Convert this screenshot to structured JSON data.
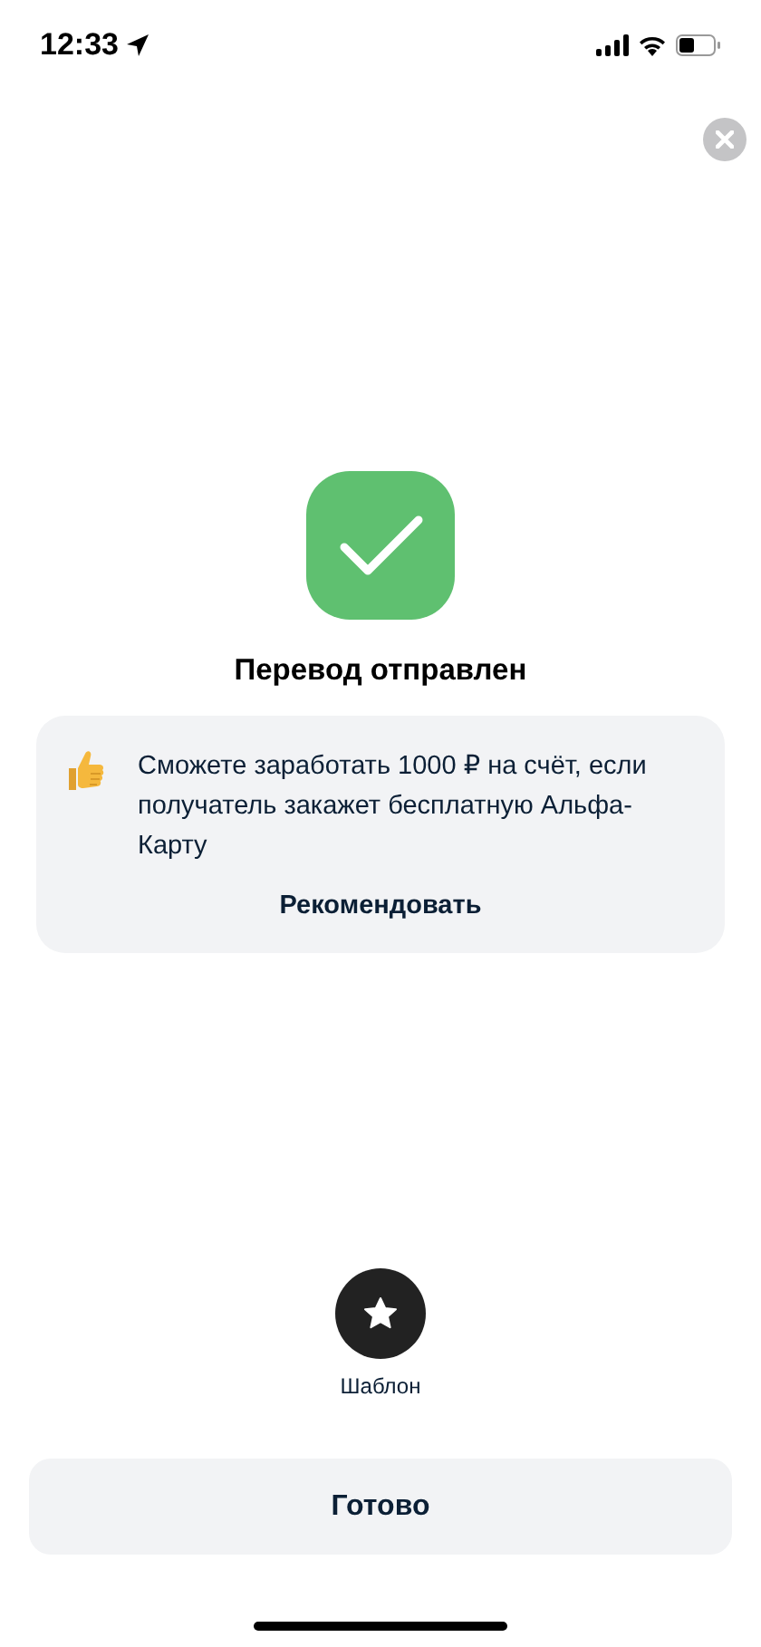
{
  "status_bar": {
    "time": "12:33"
  },
  "title": "Перевод отправлен",
  "promo": {
    "text": "Сможете заработать 1000 ₽ на счёт, если получатель закажет бесплатную Альфа-Карту",
    "action": "Рекомендовать"
  },
  "actions": [
    {
      "kind": "template",
      "label": "Шаблон"
    }
  ],
  "done_button": "Готово"
}
